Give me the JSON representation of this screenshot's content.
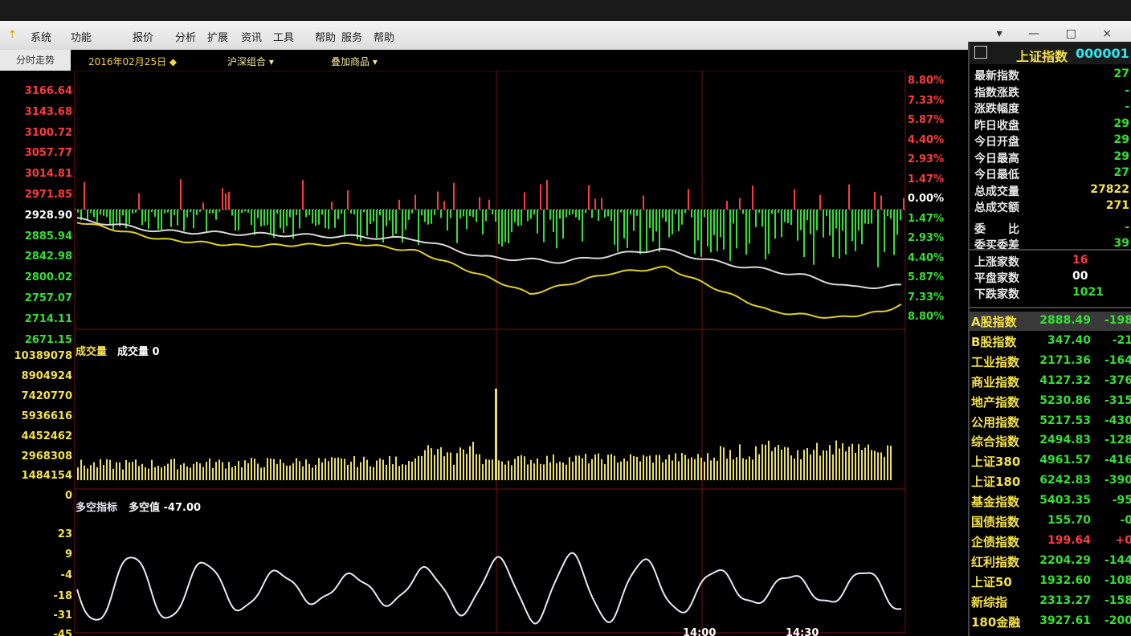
{
  "menu": {
    "items": [
      "系统",
      "功能",
      "报价",
      "分析",
      "扩展",
      "资讯",
      "工具",
      "帮助",
      "服务",
      "帮助"
    ],
    "window_controls": "▾ — □ ×"
  },
  "toolbar": {
    "left_tab": "分时走势",
    "date": "2016年02月25日 ◆",
    "group": "沪深组合 ▾",
    "overlay": "叠加商品 ▾"
  },
  "price_axis": {
    "left_labels": [
      "3166.64",
      "3143.68",
      "3100.72",
      "3057.77",
      "3014.81",
      "2971.85",
      "2928.90",
      "2885.94",
      "2842.98",
      "2800.02",
      "2757.07",
      "2714.11",
      "2671.15"
    ],
    "left_colors": [
      "red",
      "red",
      "red",
      "red",
      "red",
      "red",
      "white",
      "green",
      "green",
      "green",
      "green",
      "green",
      "green"
    ],
    "right_labels": [
      "8.80%",
      "7.33%",
      "5.87%",
      "4.40%",
      "2.93%",
      "1.47%",
      "0.00%",
      "1.47%",
      "2.93%",
      "4.40%",
      "5.87%",
      "7.33%",
      "8.80%"
    ],
    "right_colors": [
      "red",
      "red",
      "red",
      "red",
      "red",
      "red",
      "white",
      "green",
      "green",
      "green",
      "green",
      "green",
      "green"
    ]
  },
  "volume_axis": {
    "labels": [
      "10389078",
      "8904924",
      "7420770",
      "5936616",
      "4452462",
      "2968308",
      "1484154",
      "0"
    ],
    "title": "成交量",
    "value_label": "成交量 0"
  },
  "indicator_axis": {
    "labels": [
      "23",
      "9",
      "-4",
      "-18",
      "-31",
      "-45"
    ],
    "title": "多空指标",
    "value_label": "多空值 -47.00"
  },
  "time_axis": {
    "labels": [
      "14:00",
      "14:30"
    ]
  },
  "side_header": {
    "title": "上证指数",
    "code": "000001"
  },
  "side_stats": [
    {
      "label": "最新指数",
      "value": "27"
    },
    {
      "label": "指数涨跌",
      "value": "-"
    },
    {
      "label": "涨跌幅度",
      "value": "-"
    },
    {
      "label": "昨日收盘",
      "value": "29"
    },
    {
      "label": "今日开盘",
      "value": "29"
    },
    {
      "label": "今日最高",
      "value": "29"
    },
    {
      "label": "今日最低",
      "value": "27"
    },
    {
      "label": "总成交量",
      "value": "27822"
    },
    {
      "label": "总成交额",
      "value": "271"
    },
    {
      "label": "委　　比",
      "value": "-"
    },
    {
      "label": "委买委差",
      "value": "39"
    }
  ],
  "side_counts": [
    {
      "label": "上涨家数",
      "value": "16"
    },
    {
      "label": "平盘家数",
      "value": "00"
    },
    {
      "label": "下跌家数",
      "value": "1021"
    }
  ],
  "side_indices": [
    {
      "name": "A股指数",
      "value": "2888.49",
      "change": "-198"
    },
    {
      "name": "B股指数",
      "value": "347.40",
      "change": "-21"
    },
    {
      "name": "工业指数",
      "value": "2171.36",
      "change": "-164"
    },
    {
      "name": "商业指数",
      "value": "4127.32",
      "change": "-376"
    },
    {
      "name": "地产指数",
      "value": "5230.86",
      "change": "-315"
    },
    {
      "name": "公用指数",
      "value": "5217.53",
      "change": "-430"
    },
    {
      "name": "综合指数",
      "value": "2494.83",
      "change": "-128"
    },
    {
      "name": "上证380",
      "value": "4961.57",
      "change": "-416"
    },
    {
      "name": "上证180",
      "value": "6242.83",
      "change": "-390"
    },
    {
      "name": "基金指数",
      "value": "5403.35",
      "change": "-95"
    },
    {
      "name": "国债指数",
      "value": "155.70",
      "change": "-0"
    },
    {
      "name": "企债指数",
      "value": "199.64",
      "change": "+0"
    },
    {
      "name": "红利指数",
      "value": "2204.29",
      "change": "-144"
    },
    {
      "name": "上证50",
      "value": "1932.60",
      "change": "-108"
    },
    {
      "name": "新综指",
      "value": "2313.27",
      "change": "-158"
    },
    {
      "name": "180金融",
      "value": "3927.61",
      "change": "-200"
    }
  ],
  "colors": {
    "up": "#ff3b3b",
    "down": "#35e035",
    "price_line": "#d9d9d9",
    "avg_line": "#e0d020",
    "volume": "#e8e06a",
    "indicator": "#e8e8f8",
    "grid": "#7a1010"
  }
}
